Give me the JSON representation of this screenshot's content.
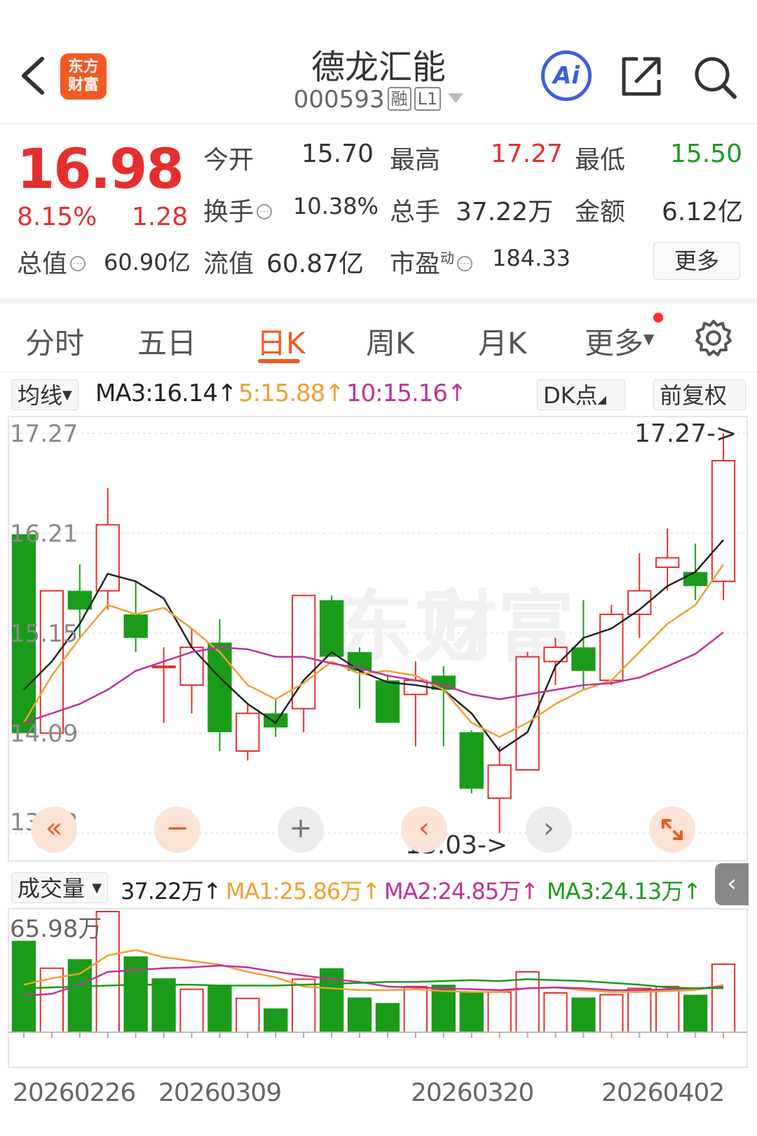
{
  "header": {
    "stock_name": "德龙汇能",
    "stock_code": "000593",
    "tag_rong": "融",
    "tag_level": "L1",
    "logo_line1": "东方",
    "logo_line2": "财富",
    "ai_label": "Ai"
  },
  "quote": {
    "price": "16.98",
    "change_pct": "8.15%",
    "change_amt": "1.28",
    "open_label": "今开",
    "open_value": "15.70",
    "high_label": "最高",
    "high_value": "17.27",
    "low_label": "最低",
    "low_value": "15.50",
    "turnover_label": "换手",
    "turnover_value": "10.38%",
    "volume_label": "总手",
    "volume_value": "37.22万",
    "amount_label": "金额",
    "amount_value": "6.12亿",
    "mktcap_label": "总值",
    "mktcap_value": "60.90亿",
    "float_label": "流值",
    "float_value": "60.87亿",
    "pe_label": "市盈",
    "pe_sup": "动",
    "pe_value": "184.33",
    "more_label": "更多"
  },
  "tabs": [
    {
      "label": "分时"
    },
    {
      "label": "五日"
    },
    {
      "label": "日K"
    },
    {
      "label": "周K"
    },
    {
      "label": "月K"
    },
    {
      "label": "更多"
    }
  ],
  "ma_bar": {
    "selector": "均线",
    "ma3": "MA3:16.14↑",
    "ma5": "5:15.88↑",
    "ma10": "10:15.16↑",
    "dk_label": "DK点",
    "adjust_label": "前复权"
  },
  "vol_bar": {
    "selector": "成交量",
    "vol": "37.22万↑",
    "ma1": "MA1:25.86万↑",
    "ma2": "MA2:24.85万↑",
    "ma3": "MA3:24.13万↑"
  },
  "colors": {
    "up": "#e62e2e",
    "down": "#1a9c1a",
    "ma_black": "#222222",
    "ma_orange": "#f0a030",
    "ma_purple": "#c0309c",
    "vol_green": "#1a9c1a",
    "accent": "#f05a22"
  },
  "chart_data": {
    "type": "candlestick",
    "price_ticks": [
      "17.27",
      "16.21",
      "15.15",
      "14.09",
      "13.03"
    ],
    "ylim": [
      13.03,
      17.27
    ],
    "high_marker": "17.27->",
    "low_marker": "13.03->",
    "candles": [
      {
        "o": 16.2,
        "c": 14.09,
        "h": 16.2,
        "l": 14.09,
        "dir": "down"
      },
      {
        "o": 14.09,
        "c": 15.6,
        "h": 15.6,
        "l": 14.09,
        "dir": "up"
      },
      {
        "o": 15.6,
        "c": 15.4,
        "h": 15.88,
        "l": 15.1,
        "dir": "down"
      },
      {
        "o": 15.6,
        "c": 16.3,
        "h": 16.69,
        "l": 15.4,
        "dir": "up"
      },
      {
        "o": 15.35,
        "c": 15.1,
        "h": 15.7,
        "l": 14.95,
        "dir": "down"
      },
      {
        "o": 14.8,
        "c": 14.8,
        "h": 15.0,
        "l": 14.2,
        "dir": "flat"
      },
      {
        "o": 14.6,
        "c": 15.0,
        "h": 15.2,
        "l": 14.3,
        "dir": "up"
      },
      {
        "o": 15.05,
        "c": 14.1,
        "h": 15.3,
        "l": 13.9,
        "dir": "down"
      },
      {
        "o": 13.9,
        "c": 14.3,
        "h": 14.4,
        "l": 13.8,
        "dir": "up"
      },
      {
        "o": 14.3,
        "c": 14.15,
        "h": 14.45,
        "l": 14.05,
        "dir": "down"
      },
      {
        "o": 14.35,
        "c": 15.55,
        "h": 15.55,
        "l": 14.1,
        "dir": "up"
      },
      {
        "o": 15.5,
        "c": 14.9,
        "h": 15.55,
        "l": 14.9,
        "dir": "down"
      },
      {
        "o": 14.95,
        "c": 14.75,
        "h": 15.0,
        "l": 14.35,
        "dir": "down"
      },
      {
        "o": 14.65,
        "c": 14.2,
        "h": 14.7,
        "l": 14.2,
        "dir": "down"
      },
      {
        "o": 14.5,
        "c": 14.65,
        "h": 14.85,
        "l": 13.95,
        "dir": "up"
      },
      {
        "o": 14.7,
        "c": 14.55,
        "h": 14.8,
        "l": 13.95,
        "dir": "down"
      },
      {
        "o": 14.1,
        "c": 13.5,
        "h": 14.12,
        "l": 13.45,
        "dir": "down"
      },
      {
        "o": 13.4,
        "c": 13.75,
        "h": 13.95,
        "l": 13.03,
        "dir": "up"
      },
      {
        "o": 13.7,
        "c": 14.9,
        "h": 14.95,
        "l": 13.7,
        "dir": "up"
      },
      {
        "o": 14.85,
        "c": 15.0,
        "h": 15.1,
        "l": 14.6,
        "dir": "up"
      },
      {
        "o": 15.0,
        "c": 14.75,
        "h": 15.5,
        "l": 14.55,
        "dir": "down"
      },
      {
        "o": 14.65,
        "c": 15.35,
        "h": 15.45,
        "l": 14.6,
        "dir": "up"
      },
      {
        "o": 15.35,
        "c": 15.6,
        "h": 16.0,
        "l": 15.1,
        "dir": "up"
      },
      {
        "o": 15.85,
        "c": 15.95,
        "h": 16.26,
        "l": 15.6,
        "dir": "up"
      },
      {
        "o": 15.8,
        "c": 15.65,
        "h": 16.1,
        "l": 15.5,
        "dir": "down"
      },
      {
        "o": 15.7,
        "c": 16.98,
        "h": 17.27,
        "l": 15.5,
        "dir": "up"
      }
    ],
    "ma_black": [
      14.55,
      14.85,
      15.25,
      15.78,
      15.7,
      15.52,
      15.0,
      14.68,
      14.4,
      14.2,
      14.65,
      14.95,
      14.75,
      14.63,
      14.6,
      14.55,
      14.3,
      13.9,
      14.1,
      14.8,
      15.1,
      15.2,
      15.4,
      15.65,
      15.8,
      16.14
    ],
    "ma_orange": [
      14.2,
      14.7,
      15.1,
      15.45,
      15.35,
      15.42,
      15.2,
      14.95,
      14.6,
      14.45,
      14.62,
      14.85,
      14.72,
      14.75,
      14.7,
      14.55,
      14.2,
      14.05,
      14.2,
      14.4,
      14.55,
      14.65,
      14.95,
      15.25,
      15.45,
      15.88
    ],
    "ma_purple": [
      14.2,
      14.3,
      14.4,
      14.55,
      14.75,
      14.85,
      14.95,
      15.0,
      14.98,
      14.9,
      14.9,
      14.83,
      14.78,
      14.7,
      14.65,
      14.6,
      14.5,
      14.45,
      14.5,
      14.55,
      14.6,
      14.62,
      14.68,
      14.8,
      14.93,
      15.16
    ]
  },
  "volume_data": {
    "max_label": "65.98万",
    "max": 65.98,
    "dates": [
      "20260226",
      "20260309",
      "20260320",
      "20260402"
    ],
    "bars": [
      {
        "v": 50.0,
        "dir": "down"
      },
      {
        "v": 35.0,
        "dir": "up"
      },
      {
        "v": 40.0,
        "dir": "down"
      },
      {
        "v": 65.98,
        "dir": "up"
      },
      {
        "v": 41.5,
        "dir": "down"
      },
      {
        "v": 29.5,
        "dir": "down"
      },
      {
        "v": 23.5,
        "dir": "up"
      },
      {
        "v": 26.0,
        "dir": "down"
      },
      {
        "v": 18.5,
        "dir": "up"
      },
      {
        "v": 13.0,
        "dir": "down"
      },
      {
        "v": 29.0,
        "dir": "up"
      },
      {
        "v": 35.0,
        "dir": "down"
      },
      {
        "v": 19.0,
        "dir": "down"
      },
      {
        "v": 16.0,
        "dir": "down"
      },
      {
        "v": 25.0,
        "dir": "up"
      },
      {
        "v": 26.0,
        "dir": "down"
      },
      {
        "v": 22.0,
        "dir": "down"
      },
      {
        "v": 22.0,
        "dir": "up"
      },
      {
        "v": 33.0,
        "dir": "up"
      },
      {
        "v": 21.5,
        "dir": "up"
      },
      {
        "v": 19.0,
        "dir": "down"
      },
      {
        "v": 20.5,
        "dir": "up"
      },
      {
        "v": 24.0,
        "dir": "up"
      },
      {
        "v": 25.0,
        "dir": "up"
      },
      {
        "v": 20.5,
        "dir": "down"
      },
      {
        "v": 37.22,
        "dir": "up"
      }
    ],
    "ma1": [
      26.0,
      29.5,
      32.0,
      42.0,
      45.0,
      41.0,
      39.0,
      37.0,
      33.0,
      30.0,
      25.0,
      24.0,
      23.0,
      23.0,
      23.5,
      22.5,
      22.0,
      22.0,
      24.0,
      24.5,
      23.0,
      22.0,
      22.0,
      22.5,
      23.0,
      25.86
    ],
    "ma2": [
      20.0,
      21.0,
      26.0,
      33.0,
      34.0,
      35.0,
      35.5,
      36.5,
      35.5,
      33.0,
      31.0,
      29.0,
      27.5,
      25.0,
      24.5,
      24.0,
      23.5,
      23.0,
      24.0,
      24.5,
      24.0,
      23.0,
      23.0,
      23.5,
      24.0,
      24.85
    ],
    "ma3": [
      24.0,
      24.5,
      25.0,
      25.5,
      26.0,
      26.0,
      26.0,
      25.5,
      25.5,
      25.5,
      26.0,
      26.5,
      27.0,
      27.5,
      27.5,
      28.0,
      28.5,
      28.0,
      29.0,
      28.5,
      28.0,
      27.0,
      26.0,
      24.5,
      24.0,
      24.13
    ]
  }
}
